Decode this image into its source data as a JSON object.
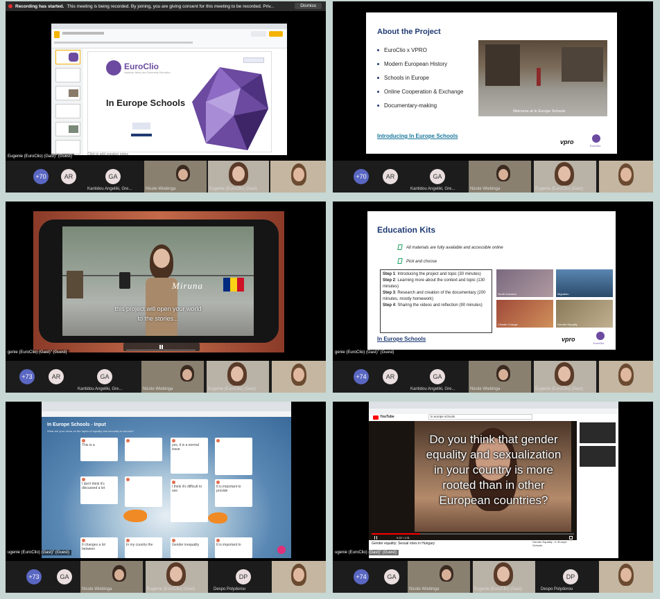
{
  "panel1": {
    "banner": {
      "bold": "Recording has started.",
      "text": "This meeting is being recorded. By joining, you are giving consent for this meeting to be recorded. Priv...",
      "dismiss": "Dismiss"
    },
    "slide": {
      "logo": "EuroClio",
      "tagline": "Inspiring History and Citizenship Education",
      "title": "In Europe Schools",
      "speaker_notes": "Click to add speaker notes"
    },
    "presenter_label": "Eugenie (EuroClio) (Gast)\" (Guest)",
    "strip": {
      "count": "+70",
      "avatars": [
        "AR",
        "GA"
      ],
      "names": [
        "Kantidou Angeliki, Gre...",
        "Nicole Wiebinga",
        "Eugenie (EuroClio) (Gast)"
      ]
    }
  },
  "panel2": {
    "slide": {
      "title": "About the Project",
      "bullets": [
        "EuroClio x VPRO",
        "Modern European History",
        "Schools in Europe",
        "Online Cooperation & Exchange",
        "Documentary-making"
      ],
      "photo_caption": "Welcome at In Europe Schools",
      "link": "Introducing In Europe Schools",
      "brand1": "vpro",
      "brand2": "EuroClio"
    },
    "strip": {
      "count": "+70",
      "avatars": [
        "AR",
        "GA"
      ],
      "names": [
        "Kantidou Angeliki, Gre...",
        "Nicole Wiebinga",
        "Eugenie (EuroClio) (Gast)"
      ]
    }
  },
  "panel3": {
    "video": {
      "name_overlay": "Miruna",
      "subtitle_line1": "this project will open your world",
      "subtitle_line2": "to the stories..."
    },
    "presenter_label": "genie (EuroClio) (Gast)\" (Guest)",
    "strip": {
      "count": "+73",
      "avatars": [
        "AR",
        "GA"
      ],
      "names": [
        "Kantidou Angeliki, Gre...",
        "Nicole Wiebinga",
        "Eugenie (EuroClio) (Gast)"
      ]
    }
  },
  "panel4": {
    "slide": {
      "title": "Education Kits",
      "line1": "All materials are fully available and accessible online",
      "line2": "Pick and choose",
      "steps": [
        {
          "label": "Step 1",
          "text": ": Introducing the project and topic (30 minutes)"
        },
        {
          "label": "Step 2",
          "text": ": Learning more about the context and topic (130 minutes)"
        },
        {
          "label": "Step 3",
          "text": ": Research and creation of the documentary (200 minutes, mostly homework)"
        },
        {
          "label": "Step 4",
          "text": ": Sharing the videos and reflection (90 minutes)"
        }
      ],
      "tiles": [
        "Youth Inclusion",
        "Migration",
        "Climate Change",
        "Gender Equality"
      ],
      "link": "In Europe Schools",
      "brand1": "vpro",
      "brand2": "EuroClio"
    },
    "presenter_label": "genie (EuroClio) (Gast)\" (Guest)",
    "strip": {
      "count": "+74",
      "avatars": [
        "AR",
        "GA"
      ],
      "names": [
        "Kantidou Angeliki, Gre...",
        "Nicole Wiebinga",
        "Eugenie (EuroClio) (Gast)"
      ]
    }
  },
  "panel5": {
    "board": {
      "title": "In Europe Schools - Input",
      "subtitle": "What are your views on the topics of equality and sexuality in schools?"
    },
    "notes": [
      "This is a",
      "yes, it is a normal issue",
      "I don't think it's discussed a lot",
      "I think it's difficult to see",
      "It is important to provide",
      "It changes a lot between",
      "Gender inequality",
      "In my country the",
      "It is important to"
    ],
    "presenter_label": "ugenie (EuroClio) (Gast)\" (Guest)",
    "strip": {
      "count": "+73",
      "avatars": [
        "GA",
        "DP"
      ],
      "names": [
        "Nicole Wiebinga",
        "Eugenie (EuroClio) (Gast)",
        "Despo Polydorou"
      ]
    }
  },
  "panel6": {
    "youtube": {
      "brand": "YouTube",
      "search": "in europe schools",
      "question": "Do you think that gender equality and sexualization in your country is more rooted than in other European countries?",
      "time": "0:22 / 1:31",
      "video_title": "Gender equality: Sexual roles in Hungary",
      "related_title": "Gender Equality - In Europe Schools"
    },
    "presenter_label": "ugenie (EuroClio) (Gast)\" (Guest)",
    "strip": {
      "count": "+74",
      "avatars": [
        "GA",
        "DP"
      ],
      "names": [
        "Nicole Wiebinga",
        "Eugenie (EuroClio) (Gast)",
        "Despo Polydorou"
      ]
    }
  },
  "colors": {
    "accent_avatar": "#5a67c2",
    "slide_blue": "#1f3a73",
    "link_teal": "#18769a",
    "euroclio_purple": "#6b4aa0",
    "page_bg": "#c7d7d3"
  }
}
